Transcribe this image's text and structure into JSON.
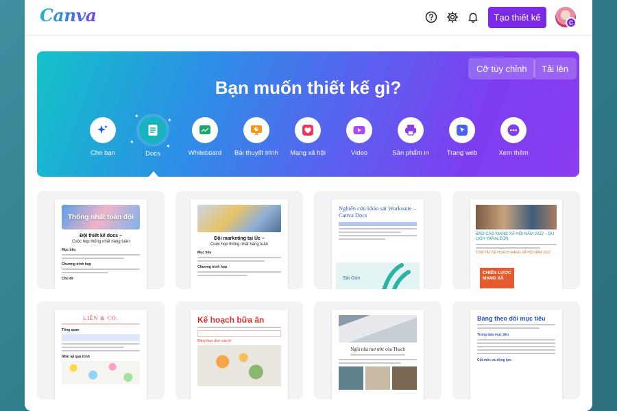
{
  "header": {
    "logo": "Canva",
    "create_button": "Tạo thiết kế",
    "avatar_badge": "C"
  },
  "hero": {
    "title": "Bạn muốn thiết kế gì?",
    "custom_size": "Cỡ tùy chỉnh",
    "upload": "Tải lên",
    "categories": [
      {
        "label": "Cho bạn",
        "icon": "sparkles-icon",
        "color": "#1a5fd0"
      },
      {
        "label": "Docs",
        "icon": "docs-icon",
        "color": "#ffffff"
      },
      {
        "label": "Whiteboard",
        "icon": "whiteboard-icon",
        "color": "#17a86b"
      },
      {
        "label": "Bài thuyết trình",
        "icon": "presentation-icon",
        "color": "#f5961d"
      },
      {
        "label": "Mạng xã hội",
        "icon": "heart-icon",
        "color": "#ea3b5c"
      },
      {
        "label": "Video",
        "icon": "video-icon",
        "color": "#a94bf0"
      },
      {
        "label": "Sản phẩm in",
        "icon": "printer-icon",
        "color": "#8b3de8"
      },
      {
        "label": "Trang web",
        "icon": "cursor-icon",
        "color": "#4a5ff0"
      },
      {
        "label": "Xem thêm",
        "icon": "more-icon",
        "color": "#7d3ef0"
      }
    ]
  },
  "templates": [
    {
      "title": "Thống nhất toàn đội",
      "heading": "Đội thiết kế docs –",
      "sub": "Cuộc họp thống nhất hàng tuần",
      "s1": "Mục tiêu",
      "s2": "Chương trình họp",
      "s3": "Chủ đề"
    },
    {
      "heading": "Đội marketing tại Úc –",
      "sub": "Cuộc họp thống nhất hàng tuần",
      "s1": "Mục tiêu",
      "s2": "Chương trình họp"
    },
    {
      "title": "Nghiên cứu khảo sát Worksuite – Canva Docs",
      "footer": "Sài Gòn"
    },
    {
      "title": "BÁO CÁO MẠNG XÃ HỘI NĂM 2022 – DU LỊCH YARALEON",
      "sub": "TÓM TẮT KẾ HOẠCH MẠNG XÃ HỘI NĂM 2022",
      "badge": "CHIẾN LƯỢC MẠNG XÃ"
    },
    {
      "title": "LIÊN & CO.",
      "s1": "Tổng quan",
      "s2": "Nhìn lại quá trình"
    },
    {
      "title": "Kế hoạch bữa ăn",
      "s1": "Bảng thực đơn của tôi"
    },
    {
      "title": "Ngôi nhà mơ ước của Thạch"
    },
    {
      "title": "Bảng theo dõi mục tiêu",
      "s1": "Trung tâm mục tiêu",
      "s2": "Cột mốc và động lực"
    }
  ]
}
